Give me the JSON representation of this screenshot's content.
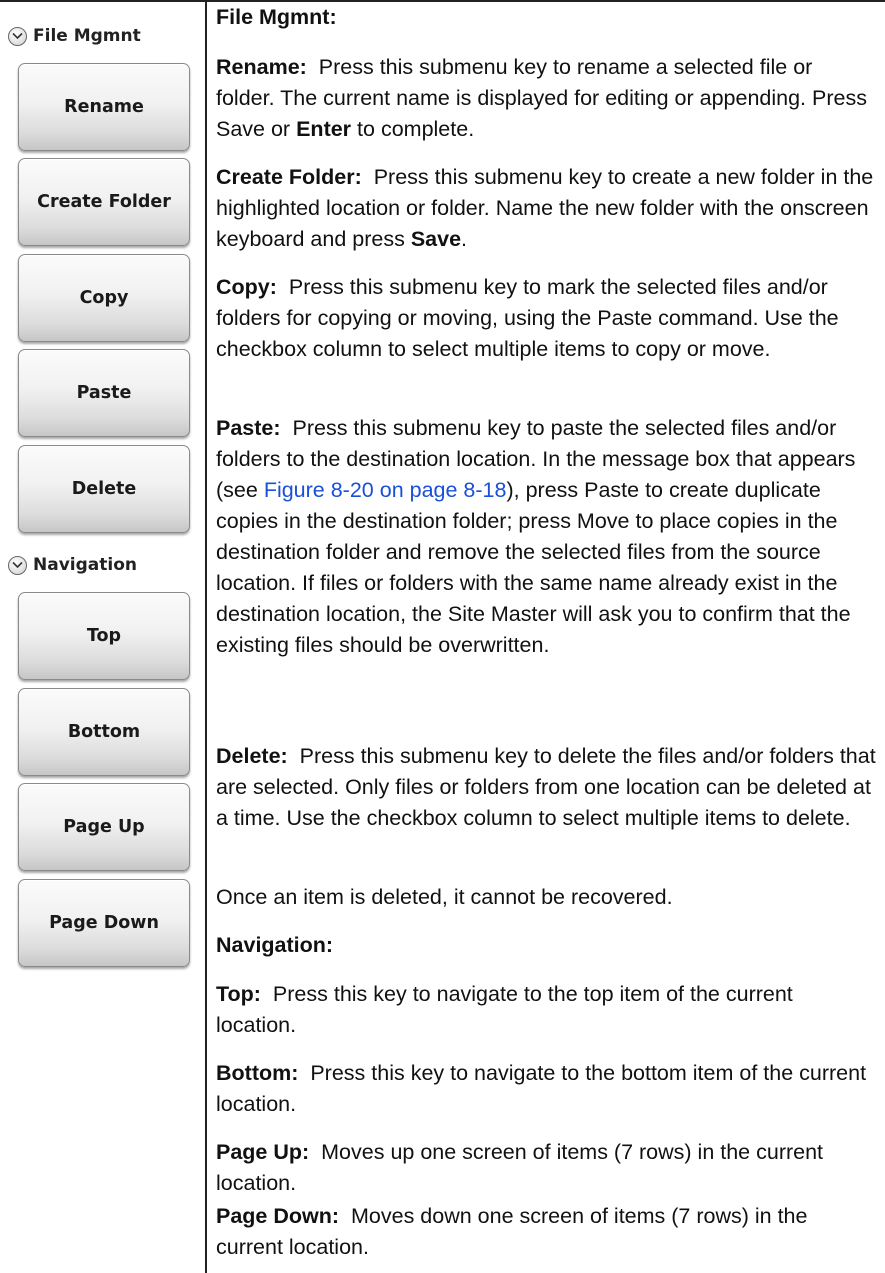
{
  "menus": {
    "file_mgmnt": {
      "title": "File Mgmnt",
      "keys": [
        "Rename",
        "Create Folder",
        "Copy",
        "Paste",
        "Delete"
      ]
    },
    "navigation": {
      "title": "Navigation",
      "keys": [
        "Top",
        "Bottom",
        "Page Up",
        "Page Down"
      ]
    }
  },
  "doc": {
    "file_mgmnt_heading": "File Mgmnt:",
    "rename": {
      "term": "Rename:",
      "text": "Press this submenu key to rename a selected file or folder. The current name is displayed for editing or appending. Press Save or",
      "bold": "Enter",
      "tail": "to complete."
    },
    "create_folder": {
      "term": "Create Folder:",
      "text": "Press this submenu key to create a new folder in the highlighted location or folder. Name the new folder with the onscreen keyboard and press",
      "bold": "Save",
      "tail": "."
    },
    "copy": {
      "term": "Copy:",
      "text": "Press this submenu key to mark the selected files and/or folders for copying or moving, using the Paste command. Use the checkbox column to select multiple items to copy or move."
    },
    "paste": {
      "term": "Paste:",
      "text_before": "Press this submenu key to paste the selected files and/or folders to the destination location. In the message box that appears (see",
      "link": "Figure 8-20 on page 8-18",
      "text_after": "), press Paste to create duplicate copies in the destination folder; press Move to place copies in the destination folder and remove the selected files from the source location. If files or folders with the same name already exist in the destination location, the Site Master will ask you to confirm that the existing files should be overwritten."
    },
    "delete": {
      "term": "Delete:",
      "text": "Press this submenu key to delete the files and/or folders that are selected. Only files or folders from one location can be deleted at a time. Use the checkbox column to select multiple items to delete."
    },
    "delete_note": "Once an item is deleted, it cannot be recovered.",
    "navigation_heading": "Navigation:",
    "top": {
      "term": "Top:",
      "text": "Press this key to navigate to the top item of the current location."
    },
    "bottom": {
      "term": "Bottom:",
      "text": "Press this key to navigate to the bottom item of the current location."
    },
    "page_up": {
      "term": "Page Up:",
      "text": "Moves up one screen of items (7 rows) in the current location."
    },
    "page_down": {
      "term": "Page Down:",
      "text": "Moves down one screen of items (7 rows) in the current location."
    }
  }
}
